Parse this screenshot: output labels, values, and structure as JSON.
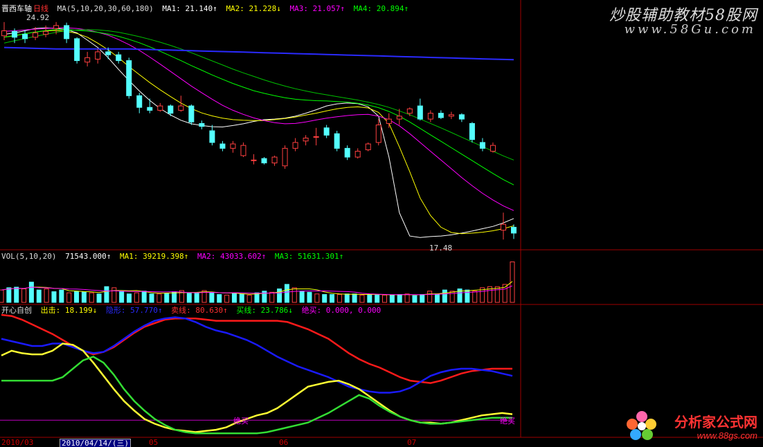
{
  "price_header": {
    "name": "晋西车轴",
    "period": "日线",
    "ma_label": "MA(5,10,20,30,60,180)",
    "ma1": "MA1: 21.140↑",
    "ma2": "MA2: 21.228↓",
    "ma3": "MA3: 21.057↑",
    "ma4": "MA4: 20.894↑",
    "high_label": "24.92",
    "low_label": "17.48"
  },
  "vol_header": {
    "label": "VOL(5,10,20)",
    "value": "71543.000↑",
    "ma1": "MA1: 39219.398↑",
    "ma2": "MA2: 43033.602↑",
    "ma3": "MA3: 51631.301↑"
  },
  "ind_header": {
    "name": "开心自创",
    "out": "出击: 18.199↓",
    "hidden": "隐形: 57.770↑",
    "sell": "卖线: 80.630↑",
    "buy": "买线: 23.786↓",
    "bottom": "绝买: 0.000, 0.000"
  },
  "annotation": {
    "text": "绝买"
  },
  "x_axis": {
    "start": "2010/03",
    "selected": "2010/04/14/(三)",
    "marks": [
      "05",
      "06",
      "07"
    ]
  },
  "watermark": {
    "line1": "炒股辅助教材58股网",
    "line2": "www.58Gu.com",
    "line3": "分析家公式网",
    "line4": "www.88gs.com"
  },
  "colors": {
    "up": "#ff4040",
    "down": "#54ffff",
    "ma5": "#ffffff",
    "ma10": "#ffff00",
    "ma20": "#ff00ff",
    "ma30": "#00ff00",
    "ma60": "#00c000",
    "ma180": "#2a2aff"
  },
  "chart_data": [
    {
      "type": "candlestick",
      "title": "晋西车轴 日线",
      "series": [
        {
          "name": "MA1",
          "values": [
            24.5,
            24.55,
            24.62,
            24.7,
            24.72,
            24.7,
            24.66,
            24.55,
            24.3,
            24.05,
            23.7,
            23.3,
            22.92,
            22.56,
            22.24,
            21.96,
            21.74,
            21.56,
            21.44,
            21.38,
            21.34,
            21.33,
            21.38,
            21.44,
            21.52,
            21.58,
            21.6,
            21.63,
            21.7,
            21.8,
            21.92,
            22.05,
            22.12,
            22.15,
            22.13,
            22.02,
            21.7,
            20.3,
            18.4,
            17.6,
            17.55,
            17.58,
            17.6,
            17.64,
            17.7,
            17.77,
            17.85,
            17.93,
            18.05,
            18.2
          ]
        },
        {
          "name": "MA2",
          "values": [
            24.4,
            24.45,
            24.52,
            24.58,
            24.62,
            24.63,
            24.6,
            24.53,
            24.4,
            24.2,
            23.97,
            23.7,
            23.4,
            23.12,
            22.85,
            22.6,
            22.37,
            22.15,
            21.96,
            21.81,
            21.71,
            21.63,
            21.58,
            21.56,
            21.55,
            21.55,
            21.58,
            21.62,
            21.67,
            21.74,
            21.8,
            21.88,
            21.95,
            22.0,
            22.02,
            21.98,
            21.83,
            21.45,
            20.65,
            19.8,
            18.9,
            18.3,
            17.9,
            17.72,
            17.68,
            17.7,
            17.73,
            17.78,
            17.85,
            17.95
          ]
        },
        {
          "name": "MA3",
          "values": [
            24.6,
            24.62,
            24.65,
            24.68,
            24.7,
            24.72,
            24.72,
            24.7,
            24.65,
            24.57,
            24.47,
            24.32,
            24.15,
            23.95,
            23.72,
            23.48,
            23.23,
            22.98,
            22.73,
            22.5,
            22.28,
            22.07,
            21.9,
            21.76,
            21.64,
            21.55,
            21.48,
            21.44,
            21.45,
            21.5,
            21.57,
            21.63,
            21.68,
            21.72,
            21.75,
            21.76,
            21.7,
            21.58,
            21.37,
            21.1,
            20.8,
            20.5,
            20.2,
            19.9,
            19.6,
            19.32,
            19.06,
            18.83,
            18.63,
            18.47
          ]
        },
        {
          "name": "MA4",
          "values": [
            24.4,
            24.46,
            24.52,
            24.58,
            24.63,
            24.66,
            24.66,
            24.64,
            24.61,
            24.57,
            24.51,
            24.43,
            24.33,
            24.21,
            24.07,
            23.92,
            23.76,
            23.6,
            23.43,
            23.27,
            23.11,
            22.96,
            22.82,
            22.69,
            22.57,
            22.48,
            22.4,
            22.33,
            22.28,
            22.25,
            22.23,
            22.22,
            22.2,
            22.18,
            22.14,
            22.08,
            21.99,
            21.86,
            21.7,
            21.5,
            21.28,
            21.06,
            20.84,
            20.62,
            20.4,
            20.18,
            19.96,
            19.74,
            19.53,
            19.35
          ]
        },
        {
          "name": "MA5",
          "values": [
            24.2,
            24.28,
            24.35,
            24.43,
            24.5,
            24.57,
            24.62,
            24.65,
            24.66,
            24.65,
            24.62,
            24.57,
            24.5,
            24.42,
            24.33,
            24.23,
            24.12,
            24.0,
            23.87,
            23.73,
            23.59,
            23.45,
            23.31,
            23.18,
            23.06,
            22.94,
            22.83,
            22.73,
            22.64,
            22.56,
            22.49,
            22.43,
            22.37,
            22.31,
            22.25,
            22.18,
            22.1,
            22.0,
            21.88,
            21.75,
            21.6,
            21.45,
            21.3,
            21.14,
            20.98,
            20.82,
            20.66,
            20.5,
            20.34,
            20.2
          ]
        },
        {
          "name": "MA6",
          "values": [
            24.05,
            24.04,
            24.03,
            24.02,
            24.01,
            24.0,
            24.0,
            24.0,
            24.0,
            24.0,
            24.0,
            24.0,
            24.0,
            23.99,
            23.98,
            23.97,
            23.96,
            23.95,
            23.94,
            23.93,
            23.92,
            23.91,
            23.9,
            23.89,
            23.88,
            23.87,
            23.86,
            23.85,
            23.84,
            23.83,
            23.82,
            23.81,
            23.8,
            23.79,
            23.78,
            23.77,
            23.76,
            23.75,
            23.74,
            23.73,
            23.72,
            23.71,
            23.7,
            23.69,
            23.68,
            23.67,
            23.66,
            23.65,
            23.64,
            23.63
          ]
        }
      ],
      "candles": [
        [
          24.45,
          24.62,
          24.92,
          24.3
        ],
        [
          24.6,
          24.4,
          24.7,
          24.2
        ],
        [
          24.5,
          24.35,
          24.65,
          24.2
        ],
        [
          24.4,
          24.55,
          24.75,
          24.3
        ],
        [
          24.5,
          24.6,
          24.8,
          24.4
        ],
        [
          24.7,
          24.8,
          24.92,
          24.5
        ],
        [
          24.8,
          24.35,
          24.9,
          24.2
        ],
        [
          24.35,
          23.6,
          24.4,
          23.5
        ],
        [
          23.55,
          23.7,
          23.9,
          23.4
        ],
        [
          23.65,
          23.9,
          24.0,
          23.5
        ],
        [
          23.9,
          23.8,
          24.05,
          23.65
        ],
        [
          23.8,
          23.6,
          23.9,
          23.5
        ],
        [
          23.6,
          22.4,
          23.7,
          22.3
        ],
        [
          22.4,
          22.0,
          22.5,
          21.8
        ],
        [
          22.0,
          21.9,
          22.3,
          21.8
        ],
        [
          21.9,
          22.05,
          22.15,
          21.85
        ],
        [
          22.05,
          21.8,
          22.1,
          21.7
        ],
        [
          21.9,
          22.05,
          22.4,
          21.85
        ],
        [
          22.05,
          21.5,
          22.1,
          21.4
        ],
        [
          21.45,
          21.35,
          21.55,
          21.25
        ],
        [
          21.2,
          20.8,
          21.4,
          20.7
        ],
        [
          20.75,
          20.6,
          20.85,
          20.5
        ],
        [
          20.6,
          20.75,
          20.85,
          20.45
        ],
        [
          20.35,
          20.7,
          20.8,
          20.3
        ],
        [
          20.2,
          20.2,
          20.4,
          20.05
        ],
        [
          20.25,
          20.1,
          20.3,
          20.05
        ],
        [
          20.1,
          20.3,
          20.35,
          20.0
        ],
        [
          20.0,
          20.6,
          20.7,
          19.9
        ],
        [
          20.6,
          20.8,
          20.95,
          20.5
        ],
        [
          20.85,
          20.95,
          21.05,
          20.7
        ],
        [
          21.0,
          21.0,
          21.3,
          20.7
        ],
        [
          21.3,
          21.05,
          21.4,
          20.95
        ],
        [
          21.1,
          20.6,
          21.2,
          20.5
        ],
        [
          20.6,
          20.3,
          20.7,
          20.2
        ],
        [
          20.3,
          20.5,
          20.6,
          20.25
        ],
        [
          20.55,
          20.75,
          20.8,
          20.5
        ],
        [
          20.8,
          21.4,
          21.6,
          20.7
        ],
        [
          21.45,
          21.6,
          21.8,
          21.3
        ],
        [
          21.6,
          21.7,
          21.95,
          21.4
        ],
        [
          21.8,
          21.95,
          22.0,
          21.7
        ],
        [
          22.05,
          21.6,
          22.3,
          21.55
        ],
        [
          21.6,
          21.8,
          21.9,
          21.5
        ],
        [
          21.8,
          21.65,
          21.9,
          21.6
        ],
        [
          21.7,
          21.75,
          21.85,
          21.6
        ],
        [
          21.75,
          21.6,
          21.8,
          21.5
        ],
        [
          21.45,
          20.9,
          21.5,
          20.8
        ],
        [
          20.8,
          20.6,
          20.95,
          20.5
        ],
        [
          20.5,
          20.7,
          20.8,
          20.45
        ],
        [
          17.8,
          18.0,
          18.4,
          17.48
        ],
        [
          17.9,
          17.7,
          18.0,
          17.5
        ]
      ],
      "ylim": [
        17.2,
        25.2
      ]
    },
    {
      "type": "bar",
      "title": "VOL(5,10,20)",
      "values": [
        22,
        26,
        27,
        24,
        36,
        22,
        24,
        19,
        22,
        17,
        19,
        19,
        17,
        15,
        28,
        26,
        19,
        15,
        17,
        20,
        15,
        15,
        16,
        19,
        21,
        16,
        17,
        21,
        18,
        14,
        13,
        17,
        15,
        13,
        17,
        20,
        18,
        24,
        32,
        26,
        20,
        18,
        15,
        14,
        14,
        14,
        15,
        15,
        13,
        14,
        14,
        13,
        13,
        14,
        15,
        12,
        14,
        20,
        15,
        22,
        20,
        24,
        22,
        20,
        26,
        28,
        28,
        32,
        72
      ],
      "ylim": [
        0,
        75
      ]
    },
    {
      "type": "line",
      "title": "开心自创",
      "series": [
        {
          "name": "卖线",
          "values": [
            100,
            99,
            96,
            92,
            88,
            84,
            79,
            74,
            70,
            67,
            69,
            73,
            79,
            85,
            90,
            93,
            96,
            97,
            97,
            97,
            96,
            95,
            95,
            95,
            95,
            95,
            95,
            95,
            94,
            91,
            88,
            84,
            80,
            74,
            68,
            63,
            59,
            56,
            52,
            48,
            45,
            44,
            43,
            45,
            48,
            51,
            53,
            54,
            55,
            55,
            55
          ]
        },
        {
          "name": "隐形",
          "values": [
            80,
            78,
            76,
            74,
            74,
            76,
            76,
            73,
            70,
            68,
            69,
            74,
            80,
            86,
            91,
            95,
            97,
            98,
            97,
            94,
            90,
            87,
            85,
            82,
            79,
            75,
            70,
            65,
            61,
            57,
            54,
            51,
            48,
            44,
            40,
            38,
            36,
            35,
            35,
            36,
            39,
            44,
            49,
            52,
            54,
            55,
            55,
            54,
            53,
            51,
            49
          ]
        },
        {
          "name": "出击",
          "values": [
            66,
            70,
            68,
            67,
            67,
            70,
            76,
            75,
            70,
            60,
            49,
            38,
            28,
            20,
            13,
            9,
            6,
            4,
            3,
            2,
            3,
            4,
            6,
            10,
            13,
            16,
            18,
            22,
            28,
            34,
            40,
            42,
            44,
            45,
            42,
            38,
            32,
            26,
            20,
            15,
            12,
            10,
            10,
            9,
            10,
            12,
            14,
            16,
            17,
            18,
            17
          ]
        },
        {
          "name": "买线",
          "values": [
            45,
            45,
            45,
            45,
            45,
            45,
            48,
            55,
            62,
            65,
            60,
            50,
            38,
            28,
            20,
            13,
            8,
            4,
            2,
            1,
            1,
            1,
            1,
            1,
            1,
            1,
            2,
            4,
            6,
            8,
            10,
            14,
            18,
            23,
            28,
            33,
            30,
            24,
            19,
            15,
            12,
            10,
            9,
            9,
            10,
            11,
            12,
            13,
            14,
            14,
            14
          ]
        }
      ],
      "annotation": "绝买",
      "ylim": [
        0,
        100
      ]
    }
  ]
}
